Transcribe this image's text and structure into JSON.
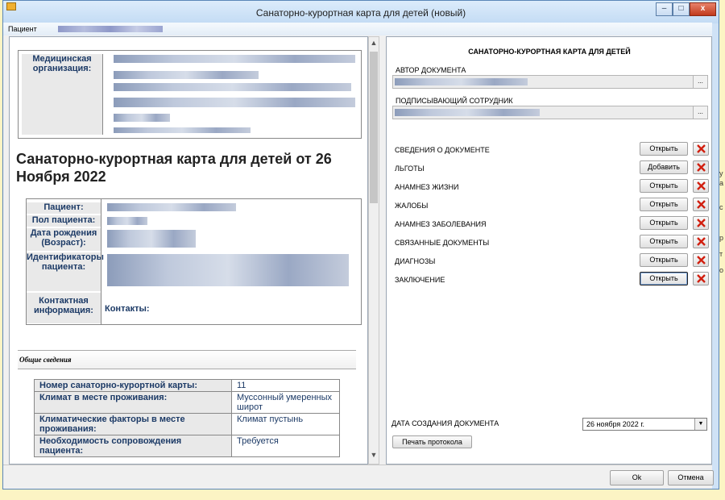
{
  "window": {
    "title": "Санаторно-курортная карта для детей (новый)",
    "minimize": "–",
    "maximize": "□",
    "close": "x"
  },
  "patient_label": "Пациент",
  "left": {
    "org_label": "Медицинская организация:",
    "doc_title": "Санаторно-курортная карта для детей от 26 Ноября 2022",
    "patient_labels": {
      "patient": "Пациент:",
      "sex": "Пол пациента:",
      "dob": "Дата рождения (Возраст):",
      "ids": "Идентификаторы пациента:",
      "contact": "Контактная информация:"
    },
    "contacts_value": "Контакты:",
    "section_title": "Общие сведения",
    "info_rows": [
      {
        "label": "Номер санаторно-курортной карты:",
        "value": "11"
      },
      {
        "label": "Климат в месте проживания:",
        "value": "Муссонный умеренных широт"
      },
      {
        "label": "Климатические факторы в месте проживания:",
        "value": "Климат пустынь"
      },
      {
        "label": "Необходимость сопровождения пациента:",
        "value": "Требуется"
      }
    ]
  },
  "right": {
    "title": "САНАТОРНО-КУРОРТНАЯ КАРТА ДЛЯ ДЕТЕЙ",
    "author_label": "АВТОР ДОКУМЕНТА",
    "signer_label": "ПОДПИСЫВАЮЩИЙ СОТРУДНИК",
    "dots": "...",
    "sections": [
      {
        "label": "СВЕДЕНИЯ О ДОКУМЕНТЕ",
        "button": "Открыть"
      },
      {
        "label": "ЛЬГОТЫ",
        "button": "Добавить"
      },
      {
        "label": "АНАМНЕЗ ЖИЗНИ",
        "button": "Открыть"
      },
      {
        "label": "ЖАЛОБЫ",
        "button": "Открыть"
      },
      {
        "label": "АНАМНЕЗ ЗАБОЛЕВАНИЯ",
        "button": "Открыть"
      },
      {
        "label": "СВЯЗАННЫЕ ДОКУМЕНТЫ",
        "button": "Открыть"
      },
      {
        "label": "ДИАГНОЗЫ",
        "button": "Открыть"
      },
      {
        "label": "ЗАКЛЮЧЕНИЕ",
        "button": "Открыть"
      }
    ],
    "date_label": "ДАТА СОЗДАНИЯ ДОКУМЕНТА",
    "date_value": "26  ноября  2022 г.",
    "print_button": "Печать протокола"
  },
  "footer": {
    "ok": "Ok",
    "cancel": "Отмена"
  }
}
